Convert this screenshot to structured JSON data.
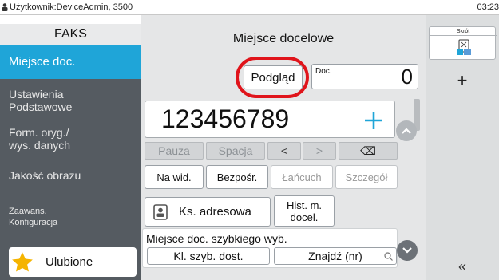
{
  "status": {
    "user": "Użytkownik:DeviceAdmin, 3500",
    "time": "03:23"
  },
  "sidebar": {
    "header": "FAKS",
    "items": [
      {
        "label": "Miejsce doc."
      },
      {
        "label1": "Ustawienia",
        "label2": "Podstawowe"
      },
      {
        "label1": "Form. oryg./",
        "label2": "wys. danych"
      },
      {
        "label": "Jakość obrazu"
      },
      {
        "label1": "Zaawans.",
        "label2": "Konfiguracja"
      }
    ],
    "favorites": "Ulubione"
  },
  "main": {
    "title": "Miejsce docelowe",
    "preview_label": "Podgląd",
    "doc_label": "Doc.",
    "doc_count": "0",
    "number_value": "123456789",
    "keys": {
      "pause": "Pauza",
      "space": "Spacja",
      "left": "<",
      "right": ">",
      "backspace": "⌫"
    },
    "views": {
      "list": "Na wid.",
      "direct": "Bezpośr.",
      "chain": "Łańcuch",
      "detail": "Szczegół"
    },
    "address_book": "Ks. adresowa",
    "history1": "Hist. m.",
    "history2": "docel.",
    "speed_dial_label": "Miejsce doc. szybkiego wyb.",
    "speed_dial_button": "Kl. szyb. dost.",
    "find_button": "Znajdź (nr)"
  },
  "right_panel": {
    "shortcut": "Skrót",
    "add": "+",
    "collapse": "«"
  },
  "colors": {
    "accent": "#1fa5d8",
    "sidebar": "#555b61",
    "highlight_ring": "#e0141b",
    "plus": "#1fa5d8"
  }
}
